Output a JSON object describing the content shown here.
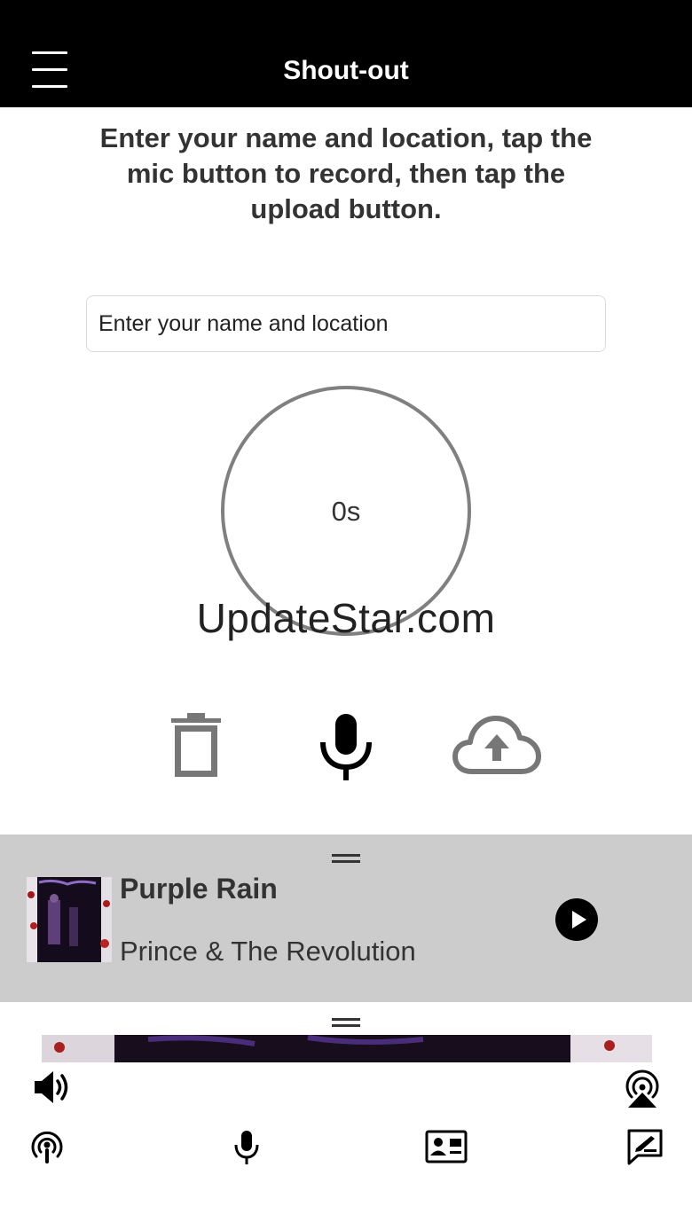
{
  "header": {
    "title": "Shout-out",
    "menu_icon": "hamburger-menu-icon"
  },
  "instructions": "Enter your name and location, tap the mic button to record, then tap the upload button.",
  "name_input": {
    "placeholder": "Enter your name and location",
    "value": ""
  },
  "recorder": {
    "elapsed": "0s"
  },
  "watermark": "UpdateStar.com",
  "controls": {
    "delete_icon": "trash-icon",
    "record_icon": "microphone-icon",
    "upload_icon": "cloud-upload-icon"
  },
  "now_playing": {
    "title": "Purple Rain",
    "artist": "Prince & The Revolution",
    "play_icon": "play-icon",
    "background": "#cccccc"
  },
  "bottom_nav": {
    "icons": [
      "volume-icon",
      "airplay-icon",
      "podcast-icon",
      "microphone-icon",
      "contact-card-icon",
      "compose-message-icon"
    ]
  },
  "colors": {
    "header_bg": "#000000",
    "text": "#333333",
    "circle_border": "#808080"
  }
}
